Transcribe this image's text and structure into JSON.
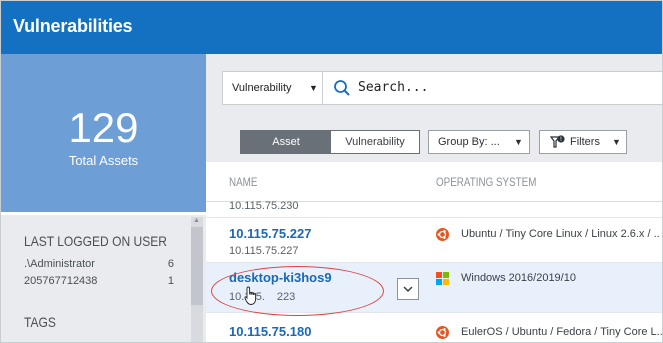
{
  "window": {
    "title": "Vulnerabilities"
  },
  "summary": {
    "count": "129",
    "label": "Total Assets"
  },
  "left_panel": {
    "last_logged_header": "Last Logged On User",
    "users": [
      {
        "name": ".\\Administrator",
        "count": "6"
      },
      {
        "name": "205767712438",
        "count": "1"
      }
    ],
    "tags_header": "Tags"
  },
  "search": {
    "scope": "Vulnerability",
    "placeholder": "Search..."
  },
  "view_toggle": {
    "asset": "Asset",
    "vulnerability": "Vulnerability",
    "active": "Asset"
  },
  "group_by": {
    "label": "Group By: ..."
  },
  "filters": {
    "label": "Filters"
  },
  "columns": {
    "name": "Name",
    "os": "Operating System"
  },
  "rows": [
    {
      "name": "",
      "ip": "10.115.75.230",
      "os": ""
    },
    {
      "name": "10.115.75.227",
      "ip": "10.115.75.227",
      "os": "Ubuntu / Tiny Core Linux / Linux 2.6.x / ..",
      "os_icon": "ubuntu-icon"
    },
    {
      "name": "desktop-ki3hos9",
      "ip_left": "10.115.",
      "ip_right": "223",
      "os": "Windows 2016/2019/10",
      "os_icon": "windows-icon"
    },
    {
      "name": "10.115.75.180",
      "ip": "",
      "os": "EulerOS / Ubuntu / Fedora / Tiny Core L..",
      "os_icon": "ubuntu-icon"
    }
  ],
  "colors": {
    "titlebar": "#1470c1",
    "kpi_panel": "#6d9ed6",
    "link": "#1a68b8",
    "highlight_circle": "#e0433f",
    "ubuntu": "#e95420"
  }
}
